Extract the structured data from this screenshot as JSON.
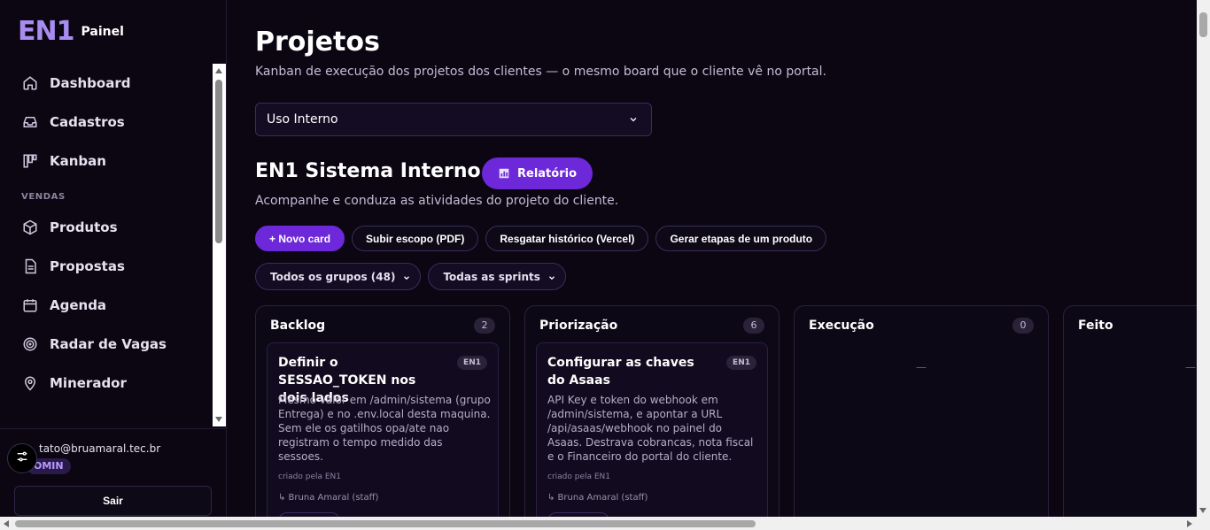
{
  "brand": {
    "logo": "EN1",
    "label": "Painel"
  },
  "sidebar": {
    "items": [
      {
        "label": "Dashboard",
        "icon": "home-icon"
      },
      {
        "label": "Cadastros",
        "icon": "inbox-icon"
      },
      {
        "label": "Kanban",
        "icon": "kanban-icon"
      }
    ],
    "section_vendas": "VENDAS",
    "sales_items": [
      {
        "label": "Produtos",
        "icon": "box-icon"
      },
      {
        "label": "Propostas",
        "icon": "document-icon"
      },
      {
        "label": "Agenda",
        "icon": "calendar-icon"
      },
      {
        "label": "Radar de Vagas",
        "icon": "target-icon"
      },
      {
        "label": "Minerador",
        "icon": "map-pin-icon"
      }
    ]
  },
  "user": {
    "email": "tato@bruamaral.tec.br",
    "role": "OMIN",
    "logout_label": "Sair"
  },
  "main": {
    "title": "Projetos",
    "subtitle": "Kanban de execução dos projetos dos clientes — o mesmo board que o cliente vê no portal.",
    "project_select": "Uso Interno",
    "project_title": "EN1 Sistema Interno",
    "report_label": "Relatório",
    "project_desc": "Acompanhe e conduza as atividades do projeto do cliente.",
    "actions": [
      "+ Novo card",
      "Subir escopo (PDF)",
      "Resgatar histórico (Vercel)",
      "Gerar etapas de um produto"
    ],
    "filters": [
      "Todos os grupos (48)",
      "Todas as sprints"
    ]
  },
  "board": {
    "columns": [
      {
        "name": "Backlog",
        "count": "2",
        "card": {
          "title": "Definir o SESSAO_TOKEN nos dois lados",
          "tag": "EN1",
          "body": "Mesmo valor em /admin/sistema (grupo Entrega) e no .env.local desta maquina. Sem ele os gatilhos opa/ate nao registram o tempo medido das sessoes.",
          "meta": "criado pela EN1",
          "owner": "↳ Bruna Amaral (staff)"
        }
      },
      {
        "name": "Priorização",
        "count": "6",
        "card": {
          "title": "Configurar as chaves do Asaas",
          "tag": "EN1",
          "body": "API Key e token do webhook em /admin/sistema, e apontar a URL /api/asaas/webhook no painel do Asaas. Destrava cobrancas, nota fiscal e o Financeiro do portal do cliente.",
          "meta": "criado pela EN1",
          "owner": "↳ Bruna Amaral (staff)"
        }
      },
      {
        "name": "Execução",
        "count": "0",
        "empty": "—"
      },
      {
        "name": "Feito",
        "empty": "—"
      }
    ]
  },
  "colors": {
    "accent": "#6d28d9",
    "background": "#0b0611",
    "logo": "#a98cf0"
  }
}
